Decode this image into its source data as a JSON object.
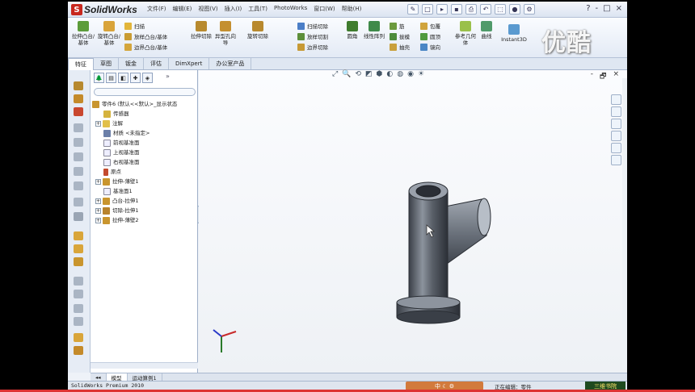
{
  "app": {
    "logo_text": "SolidWorks",
    "menus": [
      "文件(F)",
      "编辑(E)",
      "视图(V)",
      "插入(I)",
      "工具(T)",
      "PhotoWorks",
      "窗口(W)",
      "帮助(H)"
    ],
    "window_controls": [
      "?",
      "-",
      "□",
      "×"
    ]
  },
  "ribbon": {
    "big_buttons": [
      "拉伸凸台/基体",
      "旋转凸台/基体",
      "拉伸切除",
      "异型孔向导",
      "旋转切除",
      "圆角",
      "线性阵列",
      "参考几何体",
      "曲线",
      "Instant3D"
    ],
    "small_buttons": [
      "扫描",
      "放样凸台/基体",
      "边界凸台/基体",
      "扫描切除",
      "放样切割",
      "边界切除",
      "筋",
      "拔模",
      "抽壳",
      "包覆",
      "圆顶",
      "镜向"
    ],
    "watermark": "优酷"
  },
  "command_tabs": [
    "特征",
    "草图",
    "钣金",
    "评估",
    "DimXpert",
    "办公室产品"
  ],
  "feature_tree": {
    "root": "零件6  (默认<<默认>_显示状态",
    "items": [
      {
        "label": "传感器",
        "expand": ""
      },
      {
        "label": "注解",
        "expand": "+"
      },
      {
        "label": "材质 <未指定>",
        "expand": ""
      },
      {
        "label": "前视基准面",
        "expand": ""
      },
      {
        "label": "上视基准面",
        "expand": ""
      },
      {
        "label": "右视基准面",
        "expand": ""
      },
      {
        "label": "原点",
        "expand": ""
      },
      {
        "label": "拉伸-薄壁1",
        "expand": "+"
      },
      {
        "label": "基准面1",
        "expand": ""
      },
      {
        "label": "凸台-拉伸1",
        "expand": "+"
      },
      {
        "label": "切除-拉伸1",
        "expand": "+"
      },
      {
        "label": "拉伸-薄壁2",
        "expand": "+"
      }
    ]
  },
  "graphics": {
    "view_controls": [
      "- ",
      "🗗",
      "×"
    ]
  },
  "model_tabs": [
    "模型",
    "运动算例1"
  ],
  "status": {
    "left": "SolidWorks Premium 2010",
    "ime": "中 ☾ ⚙",
    "editing": "正在编辑：零件",
    "right_logo": "三维书院"
  }
}
